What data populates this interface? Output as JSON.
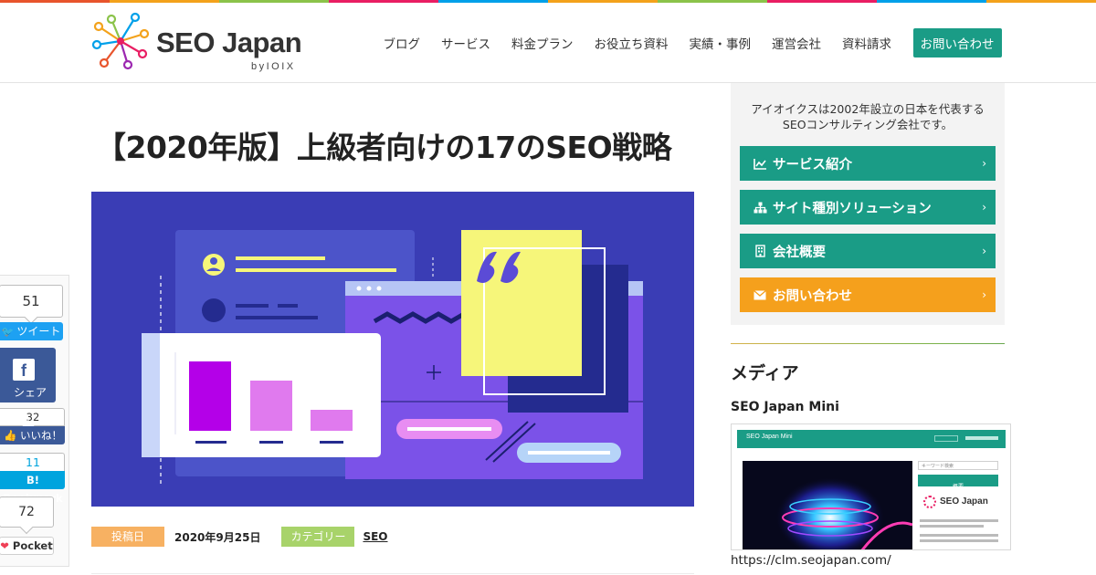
{
  "brand": {
    "name": "SEO Japan",
    "sub": "byIOIX",
    "stripe_colors": [
      "#e8542c",
      "#f3a21b",
      "#8bc34a",
      "#e91e63",
      "#00a0e9",
      "#f3a21b",
      "#8bc34a",
      "#e91e63",
      "#00a0e9",
      "#f3a21b"
    ]
  },
  "nav": {
    "items": [
      "ブログ",
      "サービス",
      "料金プラン",
      "お役立ち資料",
      "実績・事例",
      "運営会社",
      "資料請求"
    ],
    "contact": "お問い合わせ"
  },
  "article": {
    "title": "【2020年版】上級者向けの17のSEO戦略",
    "posted_label": "投稿日",
    "posted_date": "2020年9月25日",
    "category_label": "カテゴリー",
    "category": "SEO"
  },
  "share": {
    "tweet_count": "51",
    "tweet_label": "ツイート",
    "fb_share_label": "シェア",
    "like_count": "32",
    "like_label": "いいね！",
    "bookmark_count": "11",
    "bookmark_label": "Bookmark",
    "pocket_count": "72",
    "pocket_label": "Pocket"
  },
  "sidebar": {
    "intro_line1": "アイオイクスは2002年設立の日本を代表する",
    "intro_line2": "SEOコンサルティング会社です。",
    "buttons": [
      {
        "label": "サービス紹介",
        "icon": "chart-line-icon"
      },
      {
        "label": "サイト種別ソリューション",
        "icon": "sitemap-icon"
      },
      {
        "label": "会社概要",
        "icon": "building-icon"
      },
      {
        "label": "お問い合わせ",
        "icon": "envelope-icon"
      }
    ],
    "media_title": "メディア",
    "mini_title": "SEO Japan Mini",
    "mini_url": "https://clm.seojapan.com/",
    "mini_shot": {
      "header": "SEO Japan Mini",
      "search_placeholder": "キーワード検索",
      "overview": "概要",
      "logo_text": "SEO Japan"
    }
  }
}
